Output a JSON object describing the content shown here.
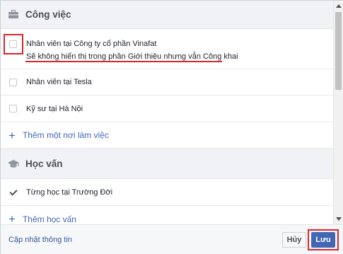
{
  "work_section": {
    "title": "Công việc",
    "icon": "briefcase-icon",
    "items": [
      {
        "label": "Nhân viên tại Công ty cổ phần Vinafat",
        "sub": "Sẽ không hiển thị trong phần Giới thiệu nhưng vẫn Công khai",
        "checked": false
      },
      {
        "label": "Nhân viên tại Tesla",
        "checked": false
      },
      {
        "label": "Kỹ sư tại Hà Nội",
        "checked": false
      }
    ],
    "add_label": "Thêm một nơi làm việc"
  },
  "education_section": {
    "title": "Học vấn",
    "icon": "graduation-cap-icon",
    "items": [
      {
        "label": "Từng học tại Trường Đời",
        "checked": true
      }
    ],
    "add_label": "Thêm học vấn"
  },
  "footer": {
    "update_link": "Cập nhật thông tin",
    "cancel_label": "Hủy",
    "save_label": "Lưu"
  },
  "colors": {
    "accent": "#4267b2",
    "highlight": "#d9262b"
  }
}
